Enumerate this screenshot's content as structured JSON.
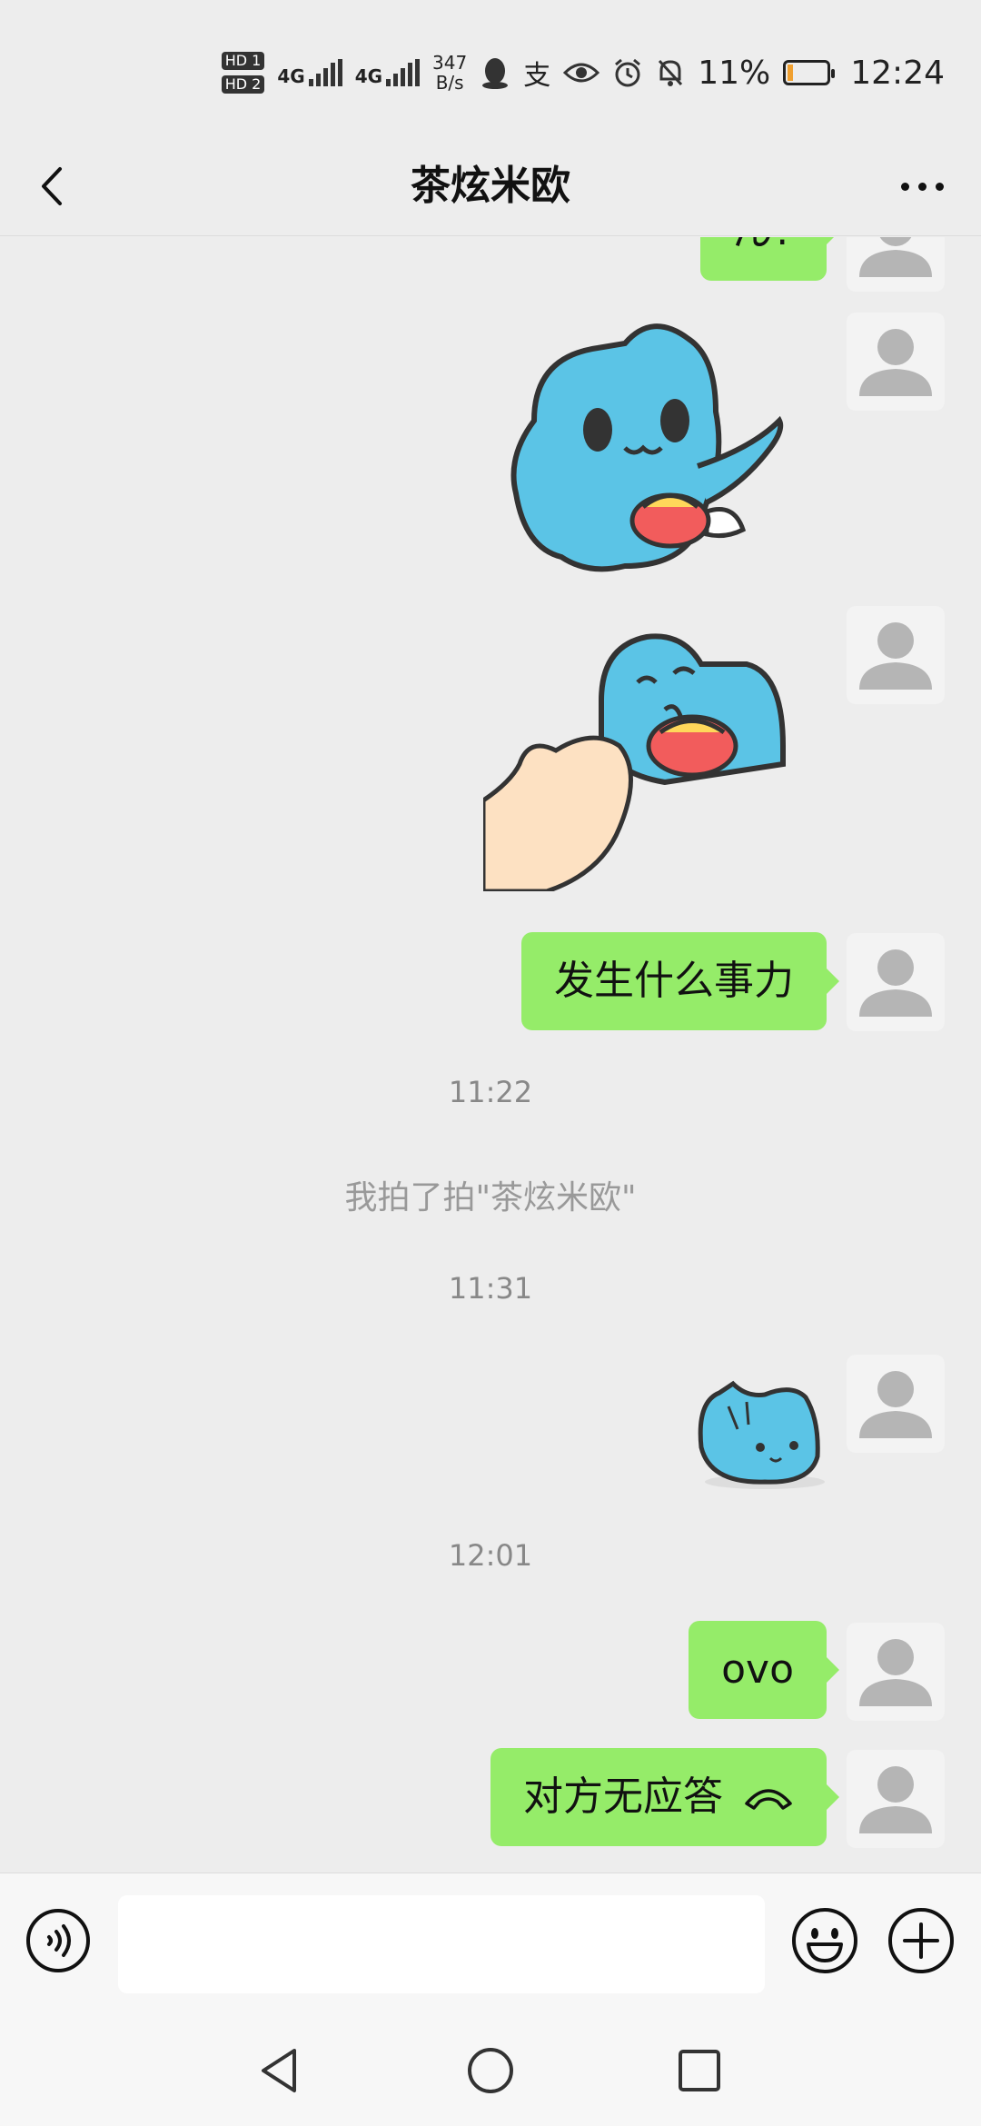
{
  "status_bar": {
    "sim1": "HD 1",
    "sim2": "HD 2",
    "net1": "4G",
    "net2": "4G",
    "speed_value": "347",
    "speed_unit": "B/s",
    "alipay_icon_char": "支",
    "battery_percent": "11%",
    "time": "12:24"
  },
  "header": {
    "title": "茶炫米欧"
  },
  "messages": [
    {
      "type": "text",
      "text": "ん?"
    },
    {
      "type": "sticker",
      "name": "blue cat holding purse"
    },
    {
      "type": "sticker",
      "name": "blue cat with hand"
    },
    {
      "type": "text",
      "text": "发生什么事力"
    },
    {
      "type": "time",
      "text": "11:22"
    },
    {
      "type": "system",
      "text": "我拍了拍\"茶炫米欧\""
    },
    {
      "type": "time",
      "text": "11:31"
    },
    {
      "type": "sticker",
      "name": "small blue cat"
    },
    {
      "type": "time",
      "text": "12:01"
    },
    {
      "type": "text",
      "text": "ovo"
    },
    {
      "type": "call",
      "text": "对方无应答"
    }
  ],
  "colors": {
    "background": "#ededed",
    "bubble_green": "#95ec69",
    "timestamp_gray": "#888888",
    "sticker_blue": "#5bc4e6"
  }
}
